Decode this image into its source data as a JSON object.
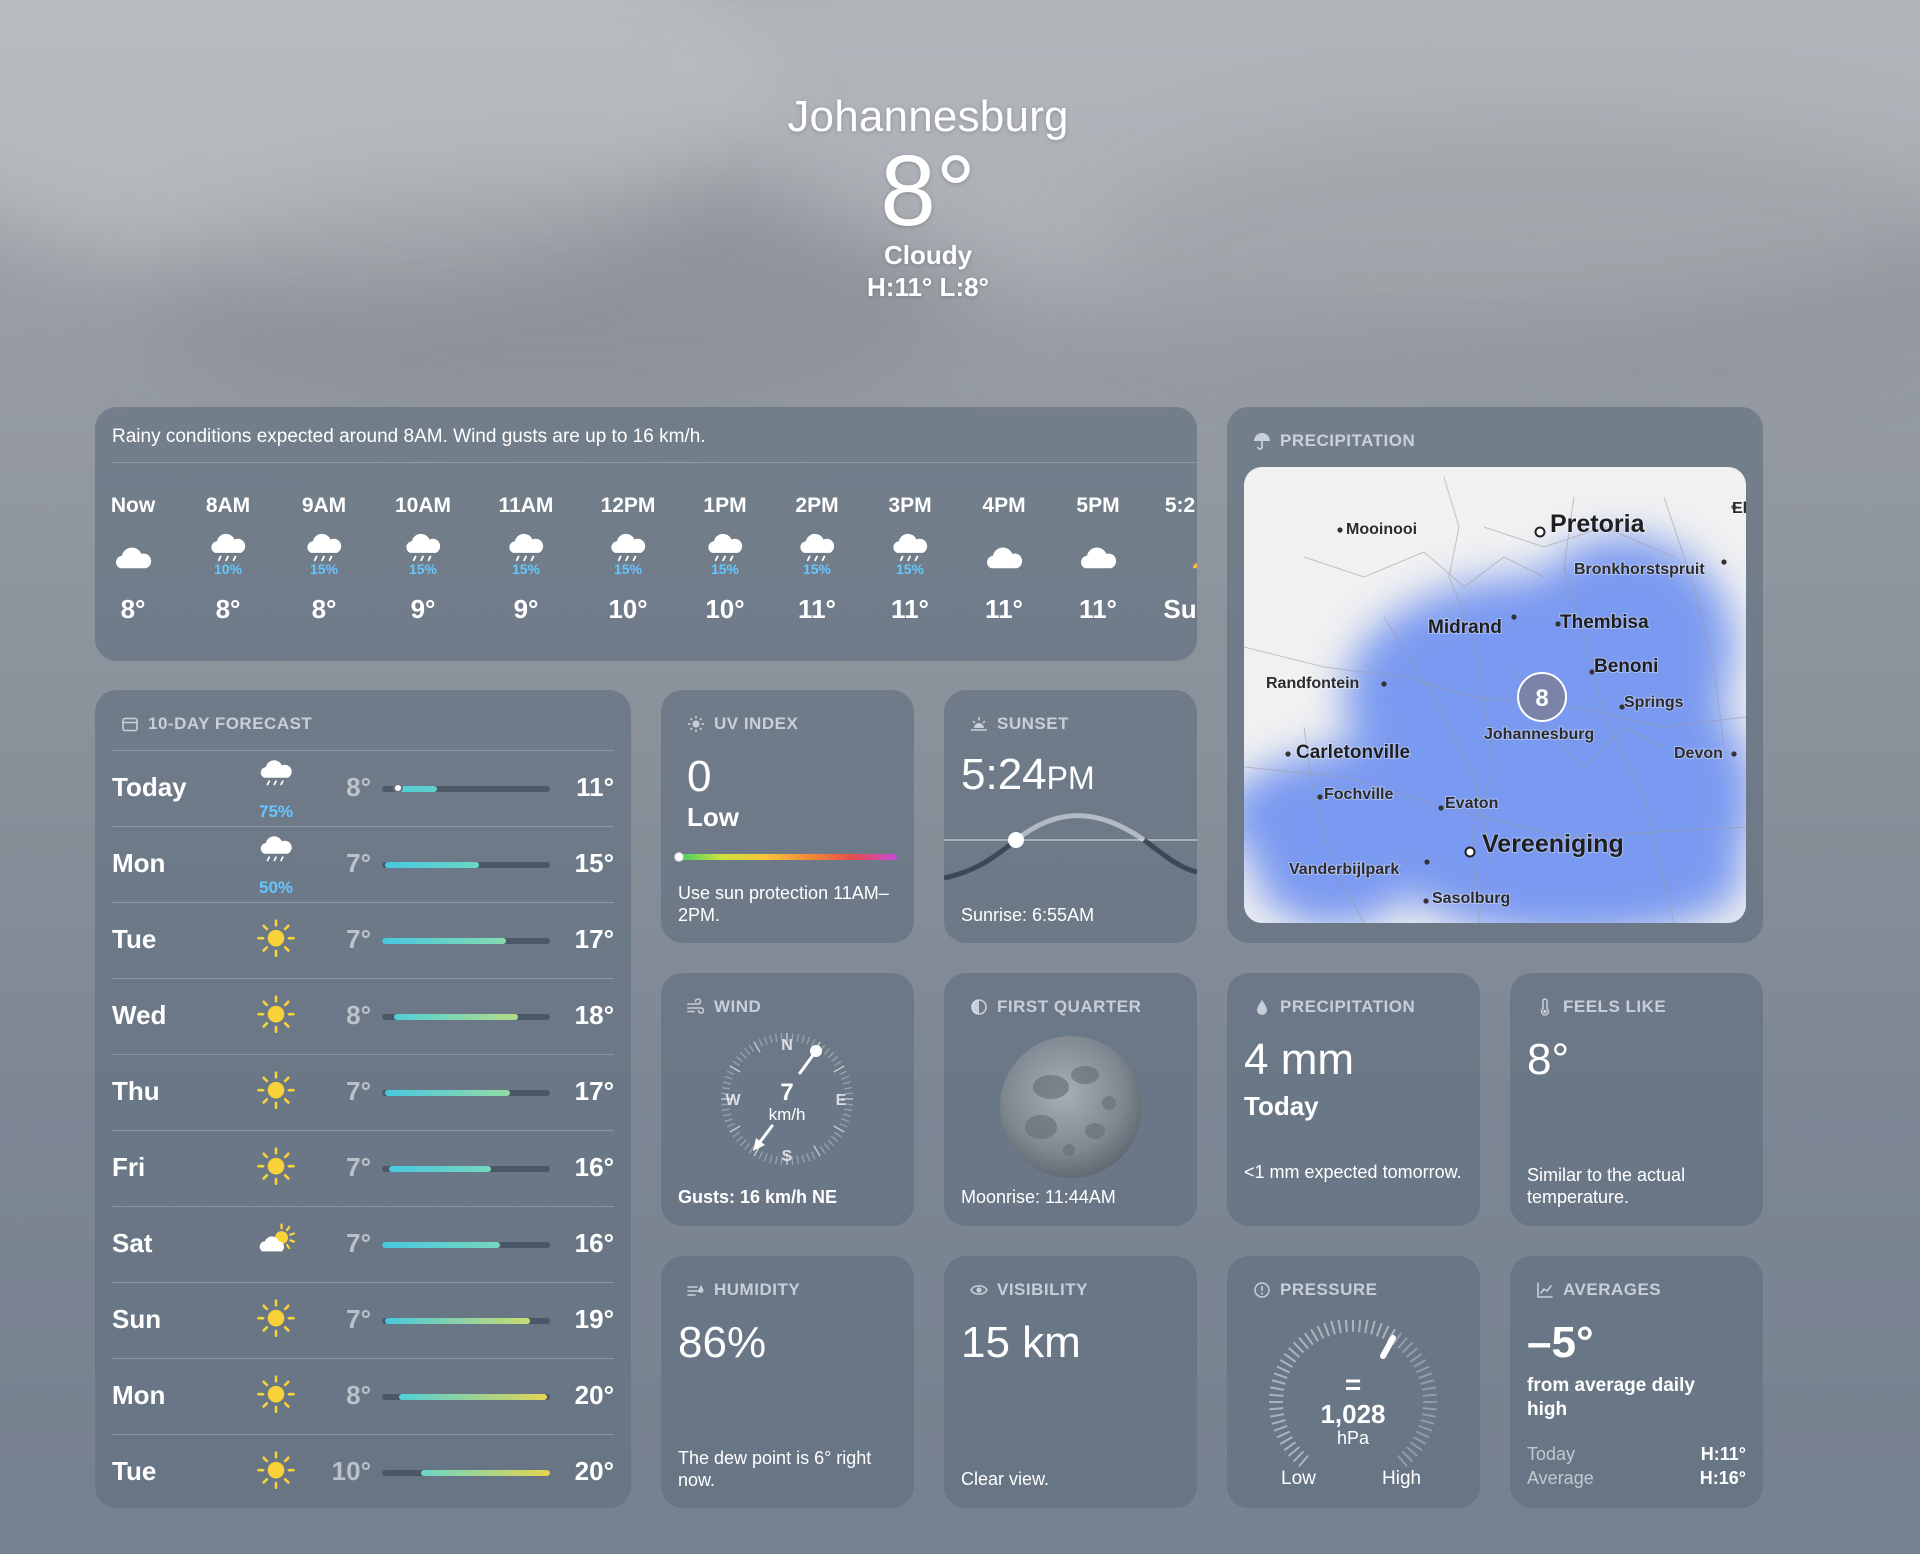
{
  "header": {
    "city": "Johannesburg",
    "temp": "8°",
    "condition": "Cloudy",
    "high_low": "H:11°  L:8°"
  },
  "hourly": {
    "summary": "Rainy conditions expected around 8AM. Wind gusts are up to 16 km/h.",
    "hours": [
      {
        "time": "Now",
        "icon": "cloud-icon",
        "precip": "",
        "temp": "8°"
      },
      {
        "time": "8AM",
        "icon": "cloud-rain-icon",
        "precip": "10%",
        "temp": "8°"
      },
      {
        "time": "9AM",
        "icon": "cloud-rain-icon",
        "precip": "15%",
        "temp": "8°"
      },
      {
        "time": "10AM",
        "icon": "cloud-rain-icon",
        "precip": "15%",
        "temp": "9°"
      },
      {
        "time": "11AM",
        "icon": "cloud-rain-icon",
        "precip": "15%",
        "temp": "9°"
      },
      {
        "time": "12PM",
        "icon": "cloud-rain-icon",
        "precip": "15%",
        "temp": "10°"
      },
      {
        "time": "1PM",
        "icon": "cloud-rain-icon",
        "precip": "15%",
        "temp": "10°"
      },
      {
        "time": "2PM",
        "icon": "cloud-rain-icon",
        "precip": "15%",
        "temp": "11°"
      },
      {
        "time": "3PM",
        "icon": "cloud-rain-icon",
        "precip": "15%",
        "temp": "11°"
      },
      {
        "time": "4PM",
        "icon": "cloud-icon",
        "precip": "",
        "temp": "11°"
      },
      {
        "time": "5PM",
        "icon": "cloud-icon",
        "precip": "",
        "temp": "11°"
      },
      {
        "time": "5:2",
        "icon": "sunset-icon",
        "precip": "",
        "temp": "Su"
      }
    ]
  },
  "forecast": {
    "title": "10-DAY FORECAST",
    "days": [
      {
        "day": "Today",
        "icon": "cloud-rain-icon",
        "precip": "75%",
        "lo": "8°",
        "hi": "11°",
        "range": [
          0.1,
          0.33
        ],
        "dot": 0.1,
        "colors": [
          "#4fd0d8",
          "#5fd0c8"
        ]
      },
      {
        "day": "Mon",
        "icon": "cloud-rain-icon",
        "precip": "50%",
        "lo": "7°",
        "hi": "15°",
        "range": [
          0.02,
          0.58
        ],
        "colors": [
          "#48c8e0",
          "#6ad6c4"
        ]
      },
      {
        "day": "Tue",
        "icon": "sun-icon",
        "precip": "",
        "lo": "7°",
        "hi": "17°",
        "range": [
          0,
          0.74
        ],
        "colors": [
          "#48c8e0",
          "#86dab0"
        ]
      },
      {
        "day": "Wed",
        "icon": "sun-icon",
        "precip": "",
        "lo": "8°",
        "hi": "18°",
        "range": [
          0.07,
          0.81
        ],
        "colors": [
          "#4fd0d8",
          "#b4dc88"
        ]
      },
      {
        "day": "Thu",
        "icon": "sun-icon",
        "precip": "",
        "lo": "7°",
        "hi": "17°",
        "range": [
          0.02,
          0.76
        ],
        "colors": [
          "#48c8e0",
          "#94dba2"
        ]
      },
      {
        "day": "Fri",
        "icon": "sun-icon",
        "precip": "",
        "lo": "7°",
        "hi": "16°",
        "range": [
          0.04,
          0.65
        ],
        "colors": [
          "#48c8e0",
          "#76d6bc"
        ]
      },
      {
        "day": "Sat",
        "icon": "partly-sunny-icon",
        "precip": "",
        "lo": "7°",
        "hi": "16°",
        "range": [
          0,
          0.7
        ],
        "colors": [
          "#48c8e0",
          "#76d6bc"
        ]
      },
      {
        "day": "Sun",
        "icon": "sun-icon",
        "precip": "",
        "lo": "7°",
        "hi": "19°",
        "range": [
          0.02,
          0.88
        ],
        "colors": [
          "#48c8e0",
          "#cadc70"
        ]
      },
      {
        "day": "Mon",
        "icon": "sun-icon",
        "precip": "",
        "lo": "8°",
        "hi": "20°",
        "range": [
          0.1,
          0.98
        ],
        "colors": [
          "#4fd0d8",
          "#e4d454"
        ]
      },
      {
        "day": "Tue",
        "icon": "sun-icon",
        "precip": "",
        "lo": "10°",
        "hi": "20°",
        "range": [
          0.23,
          1.0
        ],
        "colors": [
          "#6ad6c4",
          "#e6d44c"
        ]
      }
    ]
  },
  "precip_map": {
    "title": "PRECIPITATION",
    "marker": "8",
    "places": [
      {
        "name": "Pretoria",
        "style": "big"
      },
      {
        "name": "Mooinooi",
        "style": "small"
      },
      {
        "name": "Ek",
        "style": "small"
      },
      {
        "name": "Bronkhorstspruit",
        "style": "small"
      },
      {
        "name": "Midrand",
        "style": "medium"
      },
      {
        "name": "Thembisa",
        "style": "medium"
      },
      {
        "name": "Benoni",
        "style": "medium"
      },
      {
        "name": "Randfontein",
        "style": "small"
      },
      {
        "name": "Springs",
        "style": "small"
      },
      {
        "name": "Carletonville",
        "style": "medium"
      },
      {
        "name": "Johannesburg",
        "style": "small"
      },
      {
        "name": "Devon",
        "style": "small"
      },
      {
        "name": "Fochville",
        "style": "small"
      },
      {
        "name": "Evaton",
        "style": "small"
      },
      {
        "name": "Vereeniging",
        "style": "big"
      },
      {
        "name": "Vanderbijlpark",
        "style": "small"
      },
      {
        "name": "Sasolburg",
        "style": "small"
      }
    ]
  },
  "uv": {
    "title": "UV INDEX",
    "value": "0",
    "level": "Low",
    "note": "Use sun protection 11AM–2PM.",
    "index_fraction": 0
  },
  "sunset": {
    "title": "SUNSET",
    "time": "5:24",
    "ampm": "PM",
    "note": "Sunrise: 6:55AM"
  },
  "wind": {
    "title": "WIND",
    "speed": "7",
    "unit": "km/h",
    "dirs": {
      "n": "N",
      "e": "E",
      "s": "S",
      "w": "W"
    },
    "gusts": "Gusts: 16 km/h NE"
  },
  "moon": {
    "title": "FIRST QUARTER",
    "note": "Moonrise: 11:44AM"
  },
  "precip_total": {
    "title": "PRECIPITATION",
    "value": "4 mm",
    "period": "Today",
    "note": "<1 mm expected tomorrow."
  },
  "feels": {
    "title": "FEELS LIKE",
    "value": "8°",
    "note": "Similar to the actual temperature."
  },
  "humidity": {
    "title": "HUMIDITY",
    "value": "86%",
    "note": "The dew point is 6° right now."
  },
  "visibility": {
    "title": "VISIBILITY",
    "value": "15 km",
    "note": "Clear view."
  },
  "pressure": {
    "title": "PRESSURE",
    "trend": "=",
    "value": "1,028",
    "unit": "hPa",
    "low": "Low",
    "high": "High"
  },
  "averages": {
    "title": "AVERAGES",
    "value": "–5°",
    "desc": "from average daily high",
    "rows": [
      {
        "label": "Today",
        "value": "H:11°"
      },
      {
        "label": "Average",
        "value": "H:16°"
      }
    ]
  },
  "colors": {
    "panel": "#60707e",
    "precip_text": "#66c6ff",
    "rain_overlay": "#4d78f0"
  }
}
